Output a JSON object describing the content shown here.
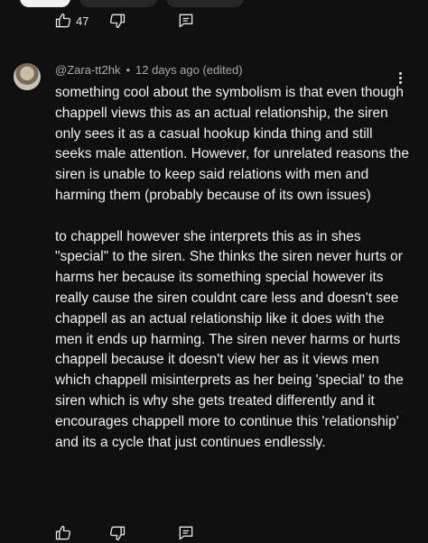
{
  "top_actions": {
    "like_count": "47"
  },
  "comment": {
    "handle": "@Zara-tt2hk",
    "separator": "•",
    "time": "12 days ago (edited)",
    "paragraphs": [
      "something cool about the symbolism is that even though chappell views this as an actual relationship, the siren only sees it as a casual hookup kinda thing and still seeks male attention. However, for unrelated reasons the siren is unable to keep said relations with men and harming them (probably because of its own issues)",
      "to chappell however she interprets this as in shes \"special\" to the siren. She thinks the siren never hurts or harms her because its something special however its really cause the siren couldnt care less and doesn't see chappell as an actual relationship like it does with the men it ends up harming. The siren never harms or hurts chappell because it doesn't view her as it views men which chappell misinterprets as her being 'special' to the siren which is why she gets treated differently and it encourages chappell more to continue this 'relationship' and its a cycle that just continues endlessly."
    ]
  },
  "icons": {
    "like": "thumbs-up-icon",
    "dislike": "thumbs-down-icon",
    "reply": "reply-comment-icon",
    "more": "more-vertical-icon"
  }
}
